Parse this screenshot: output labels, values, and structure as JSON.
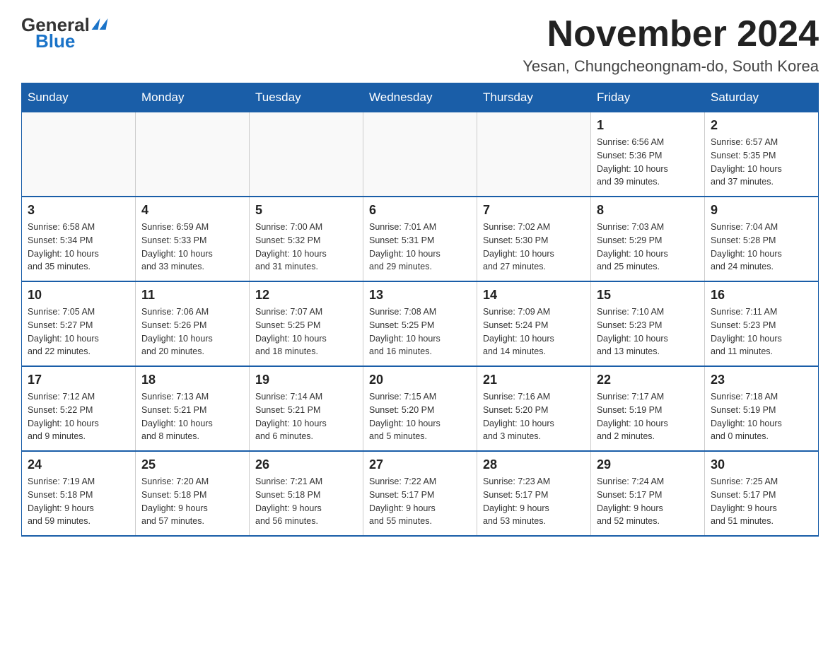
{
  "logo": {
    "general": "General",
    "blue": "Blue"
  },
  "title": "November 2024",
  "subtitle": "Yesan, Chungcheongnam-do, South Korea",
  "weekdays": [
    "Sunday",
    "Monday",
    "Tuesday",
    "Wednesday",
    "Thursday",
    "Friday",
    "Saturday"
  ],
  "weeks": [
    [
      {
        "day": "",
        "info": ""
      },
      {
        "day": "",
        "info": ""
      },
      {
        "day": "",
        "info": ""
      },
      {
        "day": "",
        "info": ""
      },
      {
        "day": "",
        "info": ""
      },
      {
        "day": "1",
        "info": "Sunrise: 6:56 AM\nSunset: 5:36 PM\nDaylight: 10 hours\nand 39 minutes."
      },
      {
        "day": "2",
        "info": "Sunrise: 6:57 AM\nSunset: 5:35 PM\nDaylight: 10 hours\nand 37 minutes."
      }
    ],
    [
      {
        "day": "3",
        "info": "Sunrise: 6:58 AM\nSunset: 5:34 PM\nDaylight: 10 hours\nand 35 minutes."
      },
      {
        "day": "4",
        "info": "Sunrise: 6:59 AM\nSunset: 5:33 PM\nDaylight: 10 hours\nand 33 minutes."
      },
      {
        "day": "5",
        "info": "Sunrise: 7:00 AM\nSunset: 5:32 PM\nDaylight: 10 hours\nand 31 minutes."
      },
      {
        "day": "6",
        "info": "Sunrise: 7:01 AM\nSunset: 5:31 PM\nDaylight: 10 hours\nand 29 minutes."
      },
      {
        "day": "7",
        "info": "Sunrise: 7:02 AM\nSunset: 5:30 PM\nDaylight: 10 hours\nand 27 minutes."
      },
      {
        "day": "8",
        "info": "Sunrise: 7:03 AM\nSunset: 5:29 PM\nDaylight: 10 hours\nand 25 minutes."
      },
      {
        "day": "9",
        "info": "Sunrise: 7:04 AM\nSunset: 5:28 PM\nDaylight: 10 hours\nand 24 minutes."
      }
    ],
    [
      {
        "day": "10",
        "info": "Sunrise: 7:05 AM\nSunset: 5:27 PM\nDaylight: 10 hours\nand 22 minutes."
      },
      {
        "day": "11",
        "info": "Sunrise: 7:06 AM\nSunset: 5:26 PM\nDaylight: 10 hours\nand 20 minutes."
      },
      {
        "day": "12",
        "info": "Sunrise: 7:07 AM\nSunset: 5:25 PM\nDaylight: 10 hours\nand 18 minutes."
      },
      {
        "day": "13",
        "info": "Sunrise: 7:08 AM\nSunset: 5:25 PM\nDaylight: 10 hours\nand 16 minutes."
      },
      {
        "day": "14",
        "info": "Sunrise: 7:09 AM\nSunset: 5:24 PM\nDaylight: 10 hours\nand 14 minutes."
      },
      {
        "day": "15",
        "info": "Sunrise: 7:10 AM\nSunset: 5:23 PM\nDaylight: 10 hours\nand 13 minutes."
      },
      {
        "day": "16",
        "info": "Sunrise: 7:11 AM\nSunset: 5:23 PM\nDaylight: 10 hours\nand 11 minutes."
      }
    ],
    [
      {
        "day": "17",
        "info": "Sunrise: 7:12 AM\nSunset: 5:22 PM\nDaylight: 10 hours\nand 9 minutes."
      },
      {
        "day": "18",
        "info": "Sunrise: 7:13 AM\nSunset: 5:21 PM\nDaylight: 10 hours\nand 8 minutes."
      },
      {
        "day": "19",
        "info": "Sunrise: 7:14 AM\nSunset: 5:21 PM\nDaylight: 10 hours\nand 6 minutes."
      },
      {
        "day": "20",
        "info": "Sunrise: 7:15 AM\nSunset: 5:20 PM\nDaylight: 10 hours\nand 5 minutes."
      },
      {
        "day": "21",
        "info": "Sunrise: 7:16 AM\nSunset: 5:20 PM\nDaylight: 10 hours\nand 3 minutes."
      },
      {
        "day": "22",
        "info": "Sunrise: 7:17 AM\nSunset: 5:19 PM\nDaylight: 10 hours\nand 2 minutes."
      },
      {
        "day": "23",
        "info": "Sunrise: 7:18 AM\nSunset: 5:19 PM\nDaylight: 10 hours\nand 0 minutes."
      }
    ],
    [
      {
        "day": "24",
        "info": "Sunrise: 7:19 AM\nSunset: 5:18 PM\nDaylight: 9 hours\nand 59 minutes."
      },
      {
        "day": "25",
        "info": "Sunrise: 7:20 AM\nSunset: 5:18 PM\nDaylight: 9 hours\nand 57 minutes."
      },
      {
        "day": "26",
        "info": "Sunrise: 7:21 AM\nSunset: 5:18 PM\nDaylight: 9 hours\nand 56 minutes."
      },
      {
        "day": "27",
        "info": "Sunrise: 7:22 AM\nSunset: 5:17 PM\nDaylight: 9 hours\nand 55 minutes."
      },
      {
        "day": "28",
        "info": "Sunrise: 7:23 AM\nSunset: 5:17 PM\nDaylight: 9 hours\nand 53 minutes."
      },
      {
        "day": "29",
        "info": "Sunrise: 7:24 AM\nSunset: 5:17 PM\nDaylight: 9 hours\nand 52 minutes."
      },
      {
        "day": "30",
        "info": "Sunrise: 7:25 AM\nSunset: 5:17 PM\nDaylight: 9 hours\nand 51 minutes."
      }
    ]
  ]
}
